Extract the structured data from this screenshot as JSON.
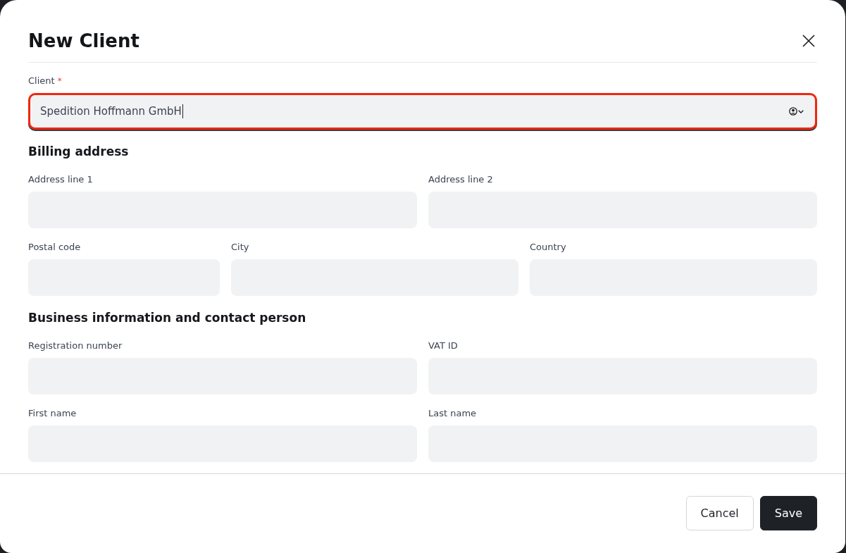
{
  "dialog": {
    "title": "New Client"
  },
  "client_field": {
    "label": "Client",
    "required_mark": "*",
    "value": "Spedition Hoffmann GmbH",
    "focused": true
  },
  "sections": [
    {
      "heading": "Billing address",
      "rows": [
        [
          {
            "label": "Address line 1"
          },
          {
            "label": "Address line 2"
          }
        ],
        [
          {
            "label": "Postal code"
          },
          {
            "label": "City"
          },
          {
            "label": "Country"
          }
        ]
      ]
    },
    {
      "heading": "Business information and contact person",
      "rows": [
        [
          {
            "label": "Registration number"
          },
          {
            "label": "VAT ID"
          }
        ],
        [
          {
            "label": "First name"
          },
          {
            "label": "Last name"
          }
        ]
      ]
    }
  ],
  "buttons": [
    {
      "label": "Cancel",
      "kind": "secondary"
    },
    {
      "label": "Save",
      "kind": "primary"
    }
  ]
}
